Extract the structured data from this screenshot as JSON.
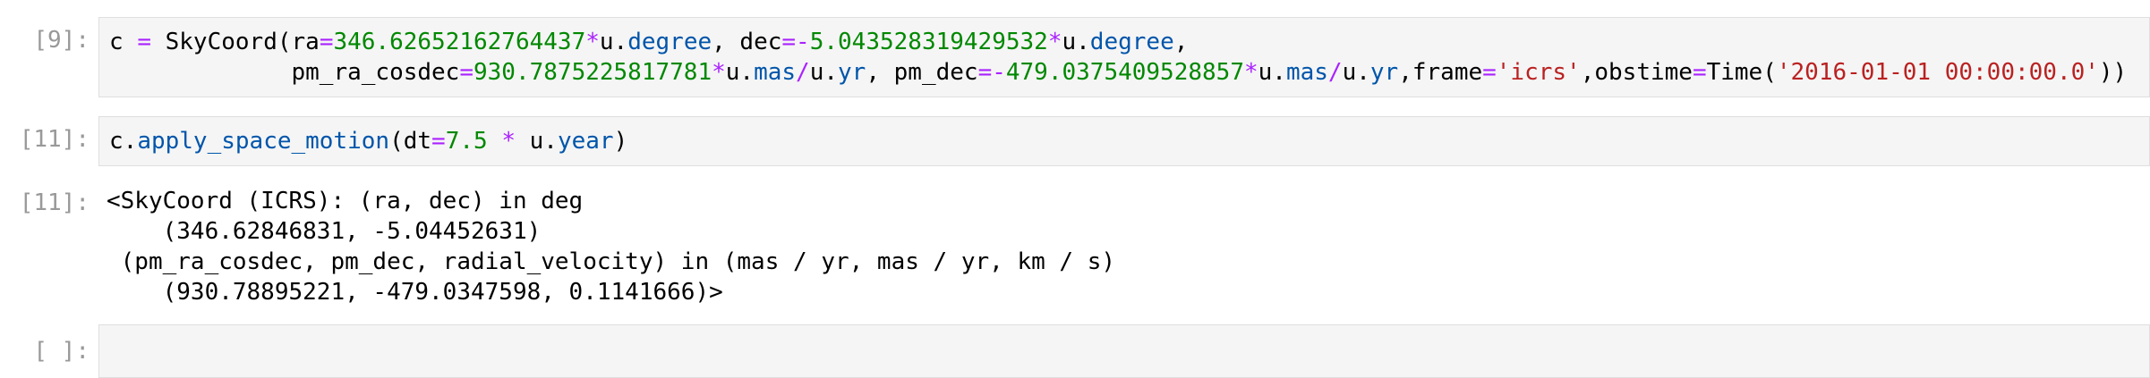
{
  "colors": {
    "prompt": "#999999",
    "input_background": "#f5f5f5",
    "input_border": "#dfdfdf",
    "operator": "#aa22ff",
    "number": "#008800",
    "attribute": "#0055aa",
    "string": "#ba2121"
  },
  "cells": [
    {
      "prompt": "[9]:",
      "type": "code",
      "lines": [
        [
          {
            "t": "c ",
            "k": "plain"
          },
          {
            "t": "=",
            "k": "op"
          },
          {
            "t": " SkyCoord(ra",
            "k": "plain"
          },
          {
            "t": "=",
            "k": "op"
          },
          {
            "t": "346.62652162764437",
            "k": "num"
          },
          {
            "t": "*",
            "k": "op"
          },
          {
            "t": "u",
            "k": "plain"
          },
          {
            "t": ".",
            "k": "plain"
          },
          {
            "t": "degree",
            "k": "attr"
          },
          {
            "t": ", dec",
            "k": "plain"
          },
          {
            "t": "=-",
            "k": "op"
          },
          {
            "t": "5.043528319429532",
            "k": "num"
          },
          {
            "t": "*",
            "k": "op"
          },
          {
            "t": "u",
            "k": "plain"
          },
          {
            "t": ".",
            "k": "plain"
          },
          {
            "t": "degree",
            "k": "attr"
          },
          {
            "t": ",",
            "k": "plain"
          }
        ],
        [
          {
            "t": "             pm_ra_cosdec",
            "k": "plain"
          },
          {
            "t": "=",
            "k": "op"
          },
          {
            "t": "930.7875225817781",
            "k": "num"
          },
          {
            "t": "*",
            "k": "op"
          },
          {
            "t": "u",
            "k": "plain"
          },
          {
            "t": ".",
            "k": "plain"
          },
          {
            "t": "mas",
            "k": "attr"
          },
          {
            "t": "/",
            "k": "op"
          },
          {
            "t": "u",
            "k": "plain"
          },
          {
            "t": ".",
            "k": "plain"
          },
          {
            "t": "yr",
            "k": "attr"
          },
          {
            "t": ", pm_dec",
            "k": "plain"
          },
          {
            "t": "=-",
            "k": "op"
          },
          {
            "t": "479.0375409528857",
            "k": "num"
          },
          {
            "t": "*",
            "k": "op"
          },
          {
            "t": "u",
            "k": "plain"
          },
          {
            "t": ".",
            "k": "plain"
          },
          {
            "t": "mas",
            "k": "attr"
          },
          {
            "t": "/",
            "k": "op"
          },
          {
            "t": "u",
            "k": "plain"
          },
          {
            "t": ".",
            "k": "plain"
          },
          {
            "t": "yr",
            "k": "attr"
          },
          {
            "t": ",frame",
            "k": "plain"
          },
          {
            "t": "=",
            "k": "op"
          },
          {
            "t": "'icrs'",
            "k": "str"
          },
          {
            "t": ",obstime",
            "k": "plain"
          },
          {
            "t": "=",
            "k": "op"
          },
          {
            "t": "Time(",
            "k": "plain"
          },
          {
            "t": "'2016-01-01 00:00:00.0'",
            "k": "str"
          },
          {
            "t": "))",
            "k": "plain"
          }
        ]
      ]
    },
    {
      "prompt": "[11]:",
      "type": "code",
      "lines": [
        [
          {
            "t": "c",
            "k": "plain"
          },
          {
            "t": ".",
            "k": "plain"
          },
          {
            "t": "apply_space_motion",
            "k": "attr"
          },
          {
            "t": "(dt",
            "k": "plain"
          },
          {
            "t": "=",
            "k": "op"
          },
          {
            "t": "7.5",
            "k": "num"
          },
          {
            "t": " ",
            "k": "plain"
          },
          {
            "t": "*",
            "k": "op"
          },
          {
            "t": " u",
            "k": "plain"
          },
          {
            "t": ".",
            "k": "plain"
          },
          {
            "t": "year",
            "k": "attr"
          },
          {
            "t": ")",
            "k": "plain"
          }
        ]
      ]
    },
    {
      "prompt": "[11]:",
      "type": "output",
      "lines": [
        "<SkyCoord (ICRS): (ra, dec) in deg",
        "    (346.62846831, -5.04452631)",
        " (pm_ra_cosdec, pm_dec, radial_velocity) in (mas / yr, mas / yr, km / s)",
        "    (930.78895221, -479.0347598, 0.1141666)>"
      ]
    },
    {
      "prompt": "[ ]:",
      "type": "code",
      "lines": []
    }
  ]
}
